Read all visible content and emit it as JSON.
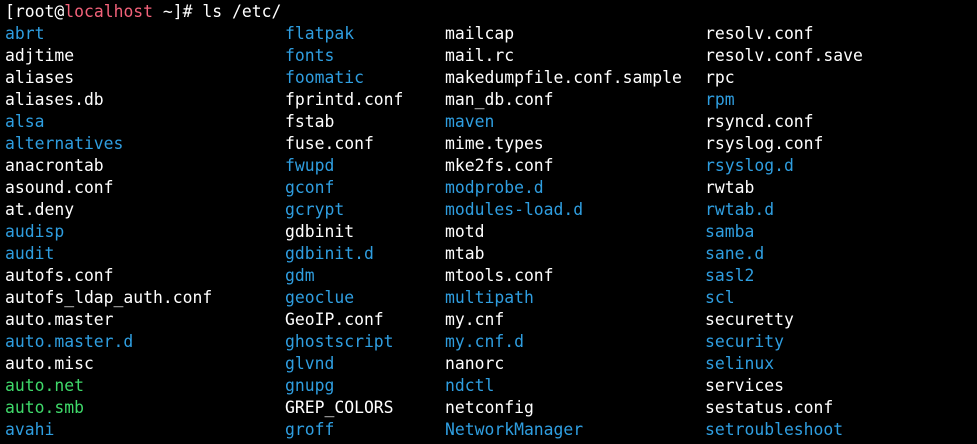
{
  "terminal": {
    "prompt": {
      "open_bracket": "[",
      "user": "root",
      "at": "@",
      "host": "localhost",
      "cwd": " ~]",
      "symbol": "# ",
      "command": "ls /etc/"
    },
    "colors": {
      "directory": "#2f9ee0",
      "file": "#ffffff",
      "executable": "#3fd96a",
      "host": "#f2627a",
      "background": "#000000"
    },
    "columns": [
      [
        {
          "name": "abrt",
          "type": "dir"
        },
        {
          "name": "adjtime",
          "type": "file"
        },
        {
          "name": "aliases",
          "type": "file"
        },
        {
          "name": "aliases.db",
          "type": "file"
        },
        {
          "name": "alsa",
          "type": "dir"
        },
        {
          "name": "alternatives",
          "type": "dir"
        },
        {
          "name": "anacrontab",
          "type": "file"
        },
        {
          "name": "asound.conf",
          "type": "file"
        },
        {
          "name": "at.deny",
          "type": "file"
        },
        {
          "name": "audisp",
          "type": "dir"
        },
        {
          "name": "audit",
          "type": "dir"
        },
        {
          "name": "autofs.conf",
          "type": "file"
        },
        {
          "name": "autofs_ldap_auth.conf",
          "type": "file"
        },
        {
          "name": "auto.master",
          "type": "file"
        },
        {
          "name": "auto.master.d",
          "type": "dir"
        },
        {
          "name": "auto.misc",
          "type": "file"
        },
        {
          "name": "auto.net",
          "type": "exec"
        },
        {
          "name": "auto.smb",
          "type": "exec"
        },
        {
          "name": "avahi",
          "type": "dir"
        }
      ],
      [
        {
          "name": "flatpak",
          "type": "dir"
        },
        {
          "name": "fonts",
          "type": "dir"
        },
        {
          "name": "foomatic",
          "type": "dir"
        },
        {
          "name": "fprintd.conf",
          "type": "file"
        },
        {
          "name": "fstab",
          "type": "file"
        },
        {
          "name": "fuse.conf",
          "type": "file"
        },
        {
          "name": "fwupd",
          "type": "dir"
        },
        {
          "name": "gconf",
          "type": "dir"
        },
        {
          "name": "gcrypt",
          "type": "dir"
        },
        {
          "name": "gdbinit",
          "type": "file"
        },
        {
          "name": "gdbinit.d",
          "type": "dir"
        },
        {
          "name": "gdm",
          "type": "dir"
        },
        {
          "name": "geoclue",
          "type": "dir"
        },
        {
          "name": "GeoIP.conf",
          "type": "file"
        },
        {
          "name": "ghostscript",
          "type": "dir"
        },
        {
          "name": "glvnd",
          "type": "dir"
        },
        {
          "name": "gnupg",
          "type": "dir"
        },
        {
          "name": "GREP_COLORS",
          "type": "file"
        },
        {
          "name": "groff",
          "type": "dir"
        }
      ],
      [
        {
          "name": "mailcap",
          "type": "file"
        },
        {
          "name": "mail.rc",
          "type": "file"
        },
        {
          "name": "makedumpfile.conf.sample",
          "type": "file"
        },
        {
          "name": "man_db.conf",
          "type": "file"
        },
        {
          "name": "maven",
          "type": "dir"
        },
        {
          "name": "mime.types",
          "type": "file"
        },
        {
          "name": "mke2fs.conf",
          "type": "file"
        },
        {
          "name": "modprobe.d",
          "type": "dir"
        },
        {
          "name": "modules-load.d",
          "type": "dir"
        },
        {
          "name": "motd",
          "type": "file"
        },
        {
          "name": "mtab",
          "type": "file"
        },
        {
          "name": "mtools.conf",
          "type": "file"
        },
        {
          "name": "multipath",
          "type": "dir"
        },
        {
          "name": "my.cnf",
          "type": "file"
        },
        {
          "name": "my.cnf.d",
          "type": "dir"
        },
        {
          "name": "nanorc",
          "type": "file"
        },
        {
          "name": "ndctl",
          "type": "dir"
        },
        {
          "name": "netconfig",
          "type": "file"
        },
        {
          "name": "NetworkManager",
          "type": "dir"
        }
      ],
      [
        {
          "name": "resolv.conf",
          "type": "file"
        },
        {
          "name": "resolv.conf.save",
          "type": "file"
        },
        {
          "name": "rpc",
          "type": "file"
        },
        {
          "name": "rpm",
          "type": "dir"
        },
        {
          "name": "rsyncd.conf",
          "type": "file"
        },
        {
          "name": "rsyslog.conf",
          "type": "file"
        },
        {
          "name": "rsyslog.d",
          "type": "dir"
        },
        {
          "name": "rwtab",
          "type": "file"
        },
        {
          "name": "rwtab.d",
          "type": "dir"
        },
        {
          "name": "samba",
          "type": "dir"
        },
        {
          "name": "sane.d",
          "type": "dir"
        },
        {
          "name": "sasl2",
          "type": "dir"
        },
        {
          "name": "scl",
          "type": "dir"
        },
        {
          "name": "securetty",
          "type": "file"
        },
        {
          "name": "security",
          "type": "dir"
        },
        {
          "name": "selinux",
          "type": "dir"
        },
        {
          "name": "services",
          "type": "file"
        },
        {
          "name": "sestatus.conf",
          "type": "file"
        },
        {
          "name": "setroubleshoot",
          "type": "dir"
        }
      ]
    ]
  }
}
